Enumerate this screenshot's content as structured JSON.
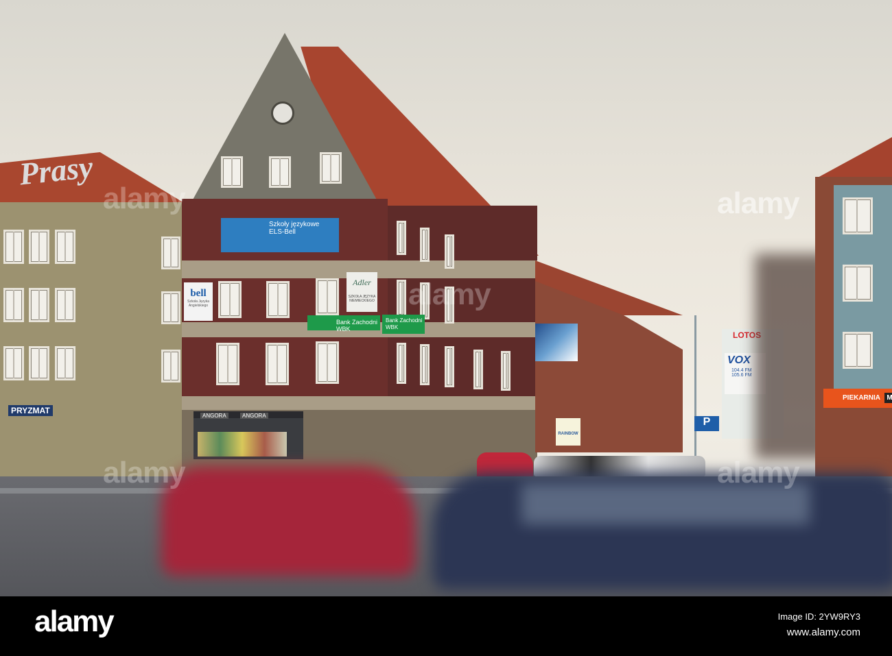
{
  "signs": {
    "neon": "Prasy",
    "pryzmat": "PRYZMAT",
    "angora_left": "ANGORA",
    "angora_right": "ANGORA",
    "els_banner": "Szkoły językowe ELS-Bell",
    "bell": "bell",
    "bell_sub": "Szkoła Języka Angielskiego",
    "adler": "Adler",
    "adler_sub": "SZKOŁA JĘZYKA NIEMIECKIEGO",
    "bank": "Bank Zachodni WBK",
    "bank_corner": "Bank Zachodni WBK",
    "rainbow": "RAINBOW",
    "lotos": "LOTOS",
    "vox": "VOX",
    "vox_freq1": "104.4 FM",
    "vox_freq2": "105.6 FM",
    "piekarnia": "PIEKARNIA",
    "piekarnia_cut": "MI",
    "parking": "P"
  },
  "watermark": {
    "overlay": "alamy",
    "logo": "alamy",
    "image_id": "Image ID: 2YW9RY3",
    "url": "www.alamy.com"
  },
  "colors": {
    "sky": "#ebe6dc",
    "brick": "#6b2f2c",
    "roof": "#a8452f",
    "bank_green": "#1e9a4a",
    "road": "#5c5d62",
    "black": "#000000"
  }
}
